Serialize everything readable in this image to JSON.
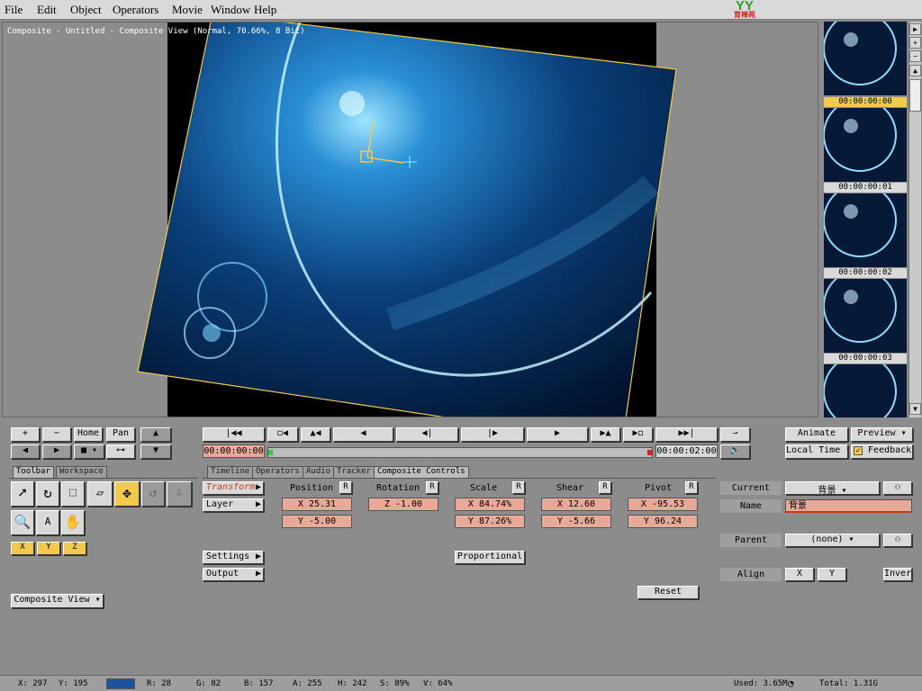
{
  "menu": [
    "File",
    "Edit",
    "Object",
    "Operators",
    "Movie",
    "Window",
    "Help"
  ],
  "logo": {
    "text": "YY",
    "subtext": "育禅苑"
  },
  "viewer": {
    "title": "Composite - Untitled - Composite View (Normal, 70.66%, 8 Bit)"
  },
  "filmstrip": {
    "frames": [
      "00:00:00:00",
      "00:00:00:01",
      "00:00:00:02",
      "00:00:00:03"
    ]
  },
  "toolbar_left": {
    "plus": "+",
    "minus": "−",
    "home": "Home",
    "pan": "Pan"
  },
  "transport": {
    "current_time": "00:00:00:00",
    "end_time": "00:00:02:00",
    "animate": "Animate",
    "preview": "Preview",
    "local_time": "Local Time",
    "feedback": "Feedback",
    "feedback_checked": true
  },
  "tabs_left": [
    "Toolbar",
    "Workspace"
  ],
  "tabs_main": [
    "Timeline",
    "Operators",
    "Audio",
    "Tracker",
    "Composite Controls"
  ],
  "axes": {
    "x": "X",
    "y": "Y",
    "z": "Z"
  },
  "composite_view": "Composite View",
  "controls": {
    "transform": "Transform",
    "layer": "Layer",
    "settings": "Settings",
    "output": "Output",
    "position": {
      "label": "Position",
      "x": "X 25.31",
      "y": "Y -5.00"
    },
    "rotation": {
      "label": "Rotation",
      "z": "Z -1.00"
    },
    "scale": {
      "label": "Scale",
      "x": "X 84.74%",
      "y": "Y 87.26%"
    },
    "shear": {
      "label": "Shear",
      "x": "X 12.60",
      "y": "Y -5.66"
    },
    "pivot": {
      "label": "Pivot",
      "x": "X -95.53",
      "y": "Y 96.24"
    },
    "reset_btn": "R",
    "proportional": "Proportional",
    "reset": "Reset"
  },
  "props": {
    "current_label": "Current",
    "current_value": "背景",
    "name_label": "Name",
    "name_value": "背景",
    "parent_label": "Parent",
    "parent_value": "(none)",
    "align_label": "Align",
    "align_x": "X",
    "align_y": "Y",
    "invert": "Invert"
  },
  "status": {
    "x": "X:  297",
    "y": "Y:  195",
    "r": "R: 28",
    "g": "G: 82",
    "b": "B: 157",
    "a": "A: 255",
    "h": "H: 242",
    "s": "S: 89%",
    "v": "V: 64%",
    "used": "Used: 3.65M",
    "total": "Total: 1.31G"
  },
  "colors": {
    "menubar": "#d9d9d9",
    "panel": "#8c8c8c",
    "field": "#e7aa98",
    "highlight": "#f2c94c"
  }
}
